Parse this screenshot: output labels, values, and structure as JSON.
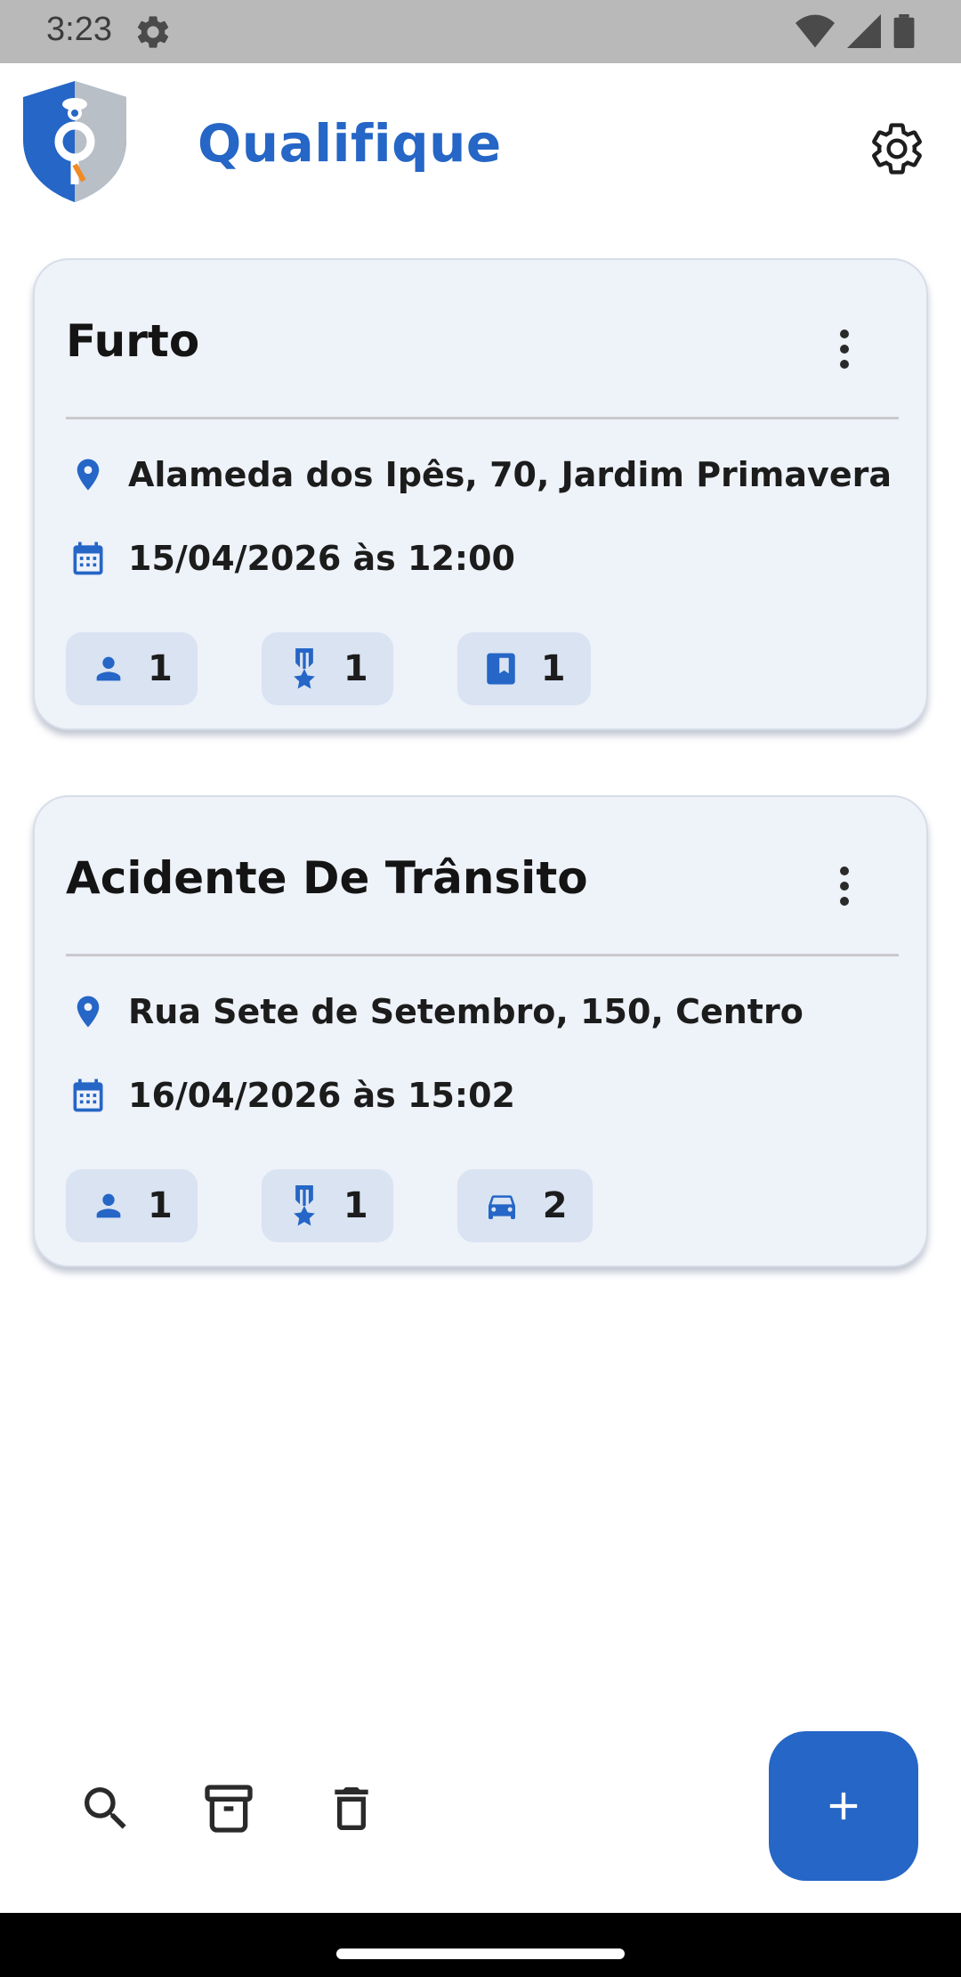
{
  "status_bar": {
    "time": "3:23"
  },
  "app": {
    "title": "Qualifique"
  },
  "cards": [
    {
      "title": "Furto",
      "address": "Alameda dos Ipês, 70, Jardim Primavera",
      "datetime": "15/04/2026 às 12:00",
      "chips": [
        {
          "icon": "person-icon",
          "count": "1"
        },
        {
          "icon": "medal-icon",
          "count": "1"
        },
        {
          "icon": "bookmark-box-icon",
          "count": "1"
        }
      ]
    },
    {
      "title": "Acidente De Trânsito",
      "address": "Rua Sete de Setembro, 150, Centro",
      "datetime": "16/04/2026 às 15:02",
      "chips": [
        {
          "icon": "person-icon",
          "count": "1"
        },
        {
          "icon": "medal-icon",
          "count": "1"
        },
        {
          "icon": "car-icon",
          "count": "2"
        }
      ]
    }
  ],
  "bottom_bar": {
    "icons": [
      "search-icon",
      "archive-icon",
      "trash-icon"
    ],
    "fab_icon": "plus-icon"
  },
  "colors": {
    "accent": "#2566c6",
    "card_bg": "#eef2f9",
    "chip_bg": "#d9e3f2"
  }
}
